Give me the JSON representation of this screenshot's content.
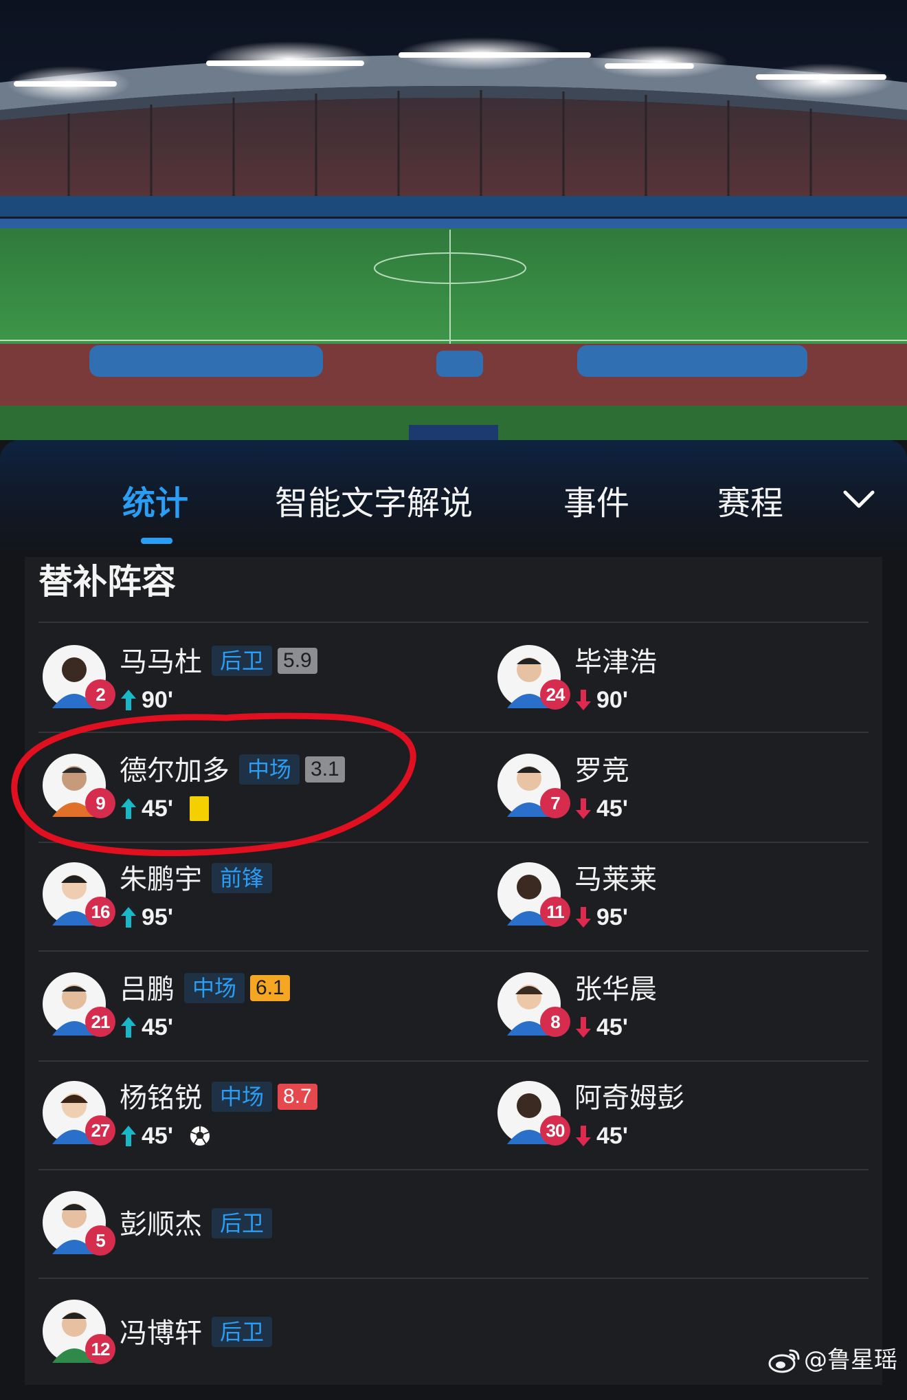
{
  "tabs": [
    {
      "label": "统计",
      "active": true
    },
    {
      "label": "智能文字解说",
      "active": false
    },
    {
      "label": "事件",
      "active": false
    },
    {
      "label": "赛程",
      "active": false
    }
  ],
  "more_icon": "chevron-down-icon",
  "section_title": "替补阵容",
  "players": {
    "p1": {
      "name": "马马杜",
      "position": "后卫",
      "rating": "5.9",
      "number": "2",
      "sub_time": "90'",
      "sub": "in"
    },
    "p2": {
      "name": "毕津浩",
      "number": "24",
      "sub_time": "90'",
      "sub": "out"
    },
    "p3": {
      "name": "德尔加多",
      "position": "中场",
      "rating": "3.1",
      "number": "9",
      "sub_time": "45'",
      "sub": "in",
      "card": "yellow"
    },
    "p4": {
      "name": "罗竞",
      "number": "7",
      "sub_time": "45'",
      "sub": "out"
    },
    "p5": {
      "name": "朱鹏宇",
      "position": "前锋",
      "number": "16",
      "sub_time": "95'",
      "sub": "in"
    },
    "p6": {
      "name": "马莱莱",
      "number": "11",
      "sub_time": "95'",
      "sub": "out"
    },
    "p7": {
      "name": "吕鹏",
      "position": "中场",
      "rating": "6.1",
      "number": "21",
      "sub_time": "45'",
      "sub": "in"
    },
    "p8": {
      "name": "张华晨",
      "number": "8",
      "sub_time": "45'",
      "sub": "out"
    },
    "p9": {
      "name": "杨铭锐",
      "position": "中场",
      "rating": "8.7",
      "number": "27",
      "sub_time": "45'",
      "sub": "in",
      "goal": true
    },
    "p10": {
      "name": "阿奇姆彭",
      "number": "30",
      "sub_time": "45'",
      "sub": "out"
    },
    "p11": {
      "name": "彭顺杰",
      "position": "后卫",
      "number": "5"
    },
    "p12": {
      "name": "冯博轩",
      "position": "后卫",
      "number": "12"
    }
  },
  "watermark": "@鲁星瑶",
  "colors": {
    "accent": "#2a9df4",
    "sub_in": "#19b8c9",
    "sub_out": "#e0294f",
    "number_badge": "#d62d4f",
    "highlight_circle": "#e01020"
  }
}
